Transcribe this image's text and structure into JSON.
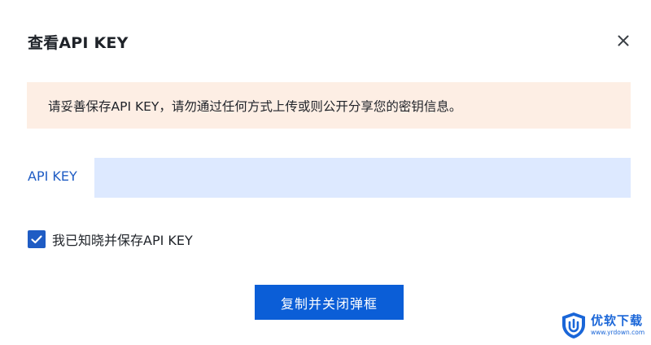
{
  "dialog": {
    "title": "查看API KEY",
    "close_icon": "close-icon"
  },
  "notice": {
    "text": "请妥善保存API KEY，请勿通过任何方式上传或则公开分享您的密钥信息。",
    "background": "#fdeee4"
  },
  "api_key": {
    "label": "API KEY",
    "value": "",
    "field_background": "#dde9ff"
  },
  "acknowledge": {
    "label": "我已知晓并保存API KEY",
    "checked": true,
    "icon": "checkmark-icon"
  },
  "actions": {
    "copy_close_label": "复制并关闭弹框"
  },
  "watermark": {
    "title": "优软下载",
    "url": "www.yrdown.com",
    "icon": "shield-logo-icon"
  },
  "colors": {
    "accent": "#1f5cc4",
    "button": "#0b5ed7"
  }
}
